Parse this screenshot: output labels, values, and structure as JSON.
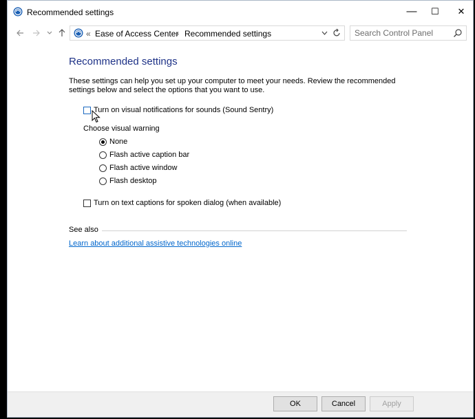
{
  "window": {
    "title": "Recommended settings",
    "controls": {
      "minimize": "—",
      "maximize": "☐",
      "close": "✕"
    }
  },
  "addressbar": {
    "back_icon": "arrow-left-icon",
    "forward_icon": "arrow-right-icon",
    "recent_icon": "chevron-down-icon",
    "up_icon": "arrow-up-icon",
    "overflow": "«",
    "breadcrumbs": [
      "Ease of Access Center",
      "Recommended settings"
    ],
    "separator": "›",
    "search_placeholder": "Search Control Panel"
  },
  "main": {
    "title": "Recommended settings",
    "description": "These settings can help you set up your computer to meet your needs. Review the recommended settings below and select the options that you want to use.",
    "sound_sentry_label": "Turn on visual notifications for sounds (Sound Sentry)",
    "visual_warning_label": "Choose visual warning",
    "visual_warning_options": [
      "None",
      "Flash active caption bar",
      "Flash active window",
      "Flash desktop"
    ],
    "selected_option": "None",
    "captions_label": "Turn on text captions for spoken dialog (when available)",
    "see_also_label": "See also",
    "link_text": "Learn about additional assistive technologies online"
  },
  "footer": {
    "ok": "OK",
    "cancel": "Cancel",
    "apply": "Apply"
  },
  "colors": {
    "title_blue": "#1e3287",
    "link_blue": "#0066cc",
    "footer_bg": "#f0f0f0"
  }
}
